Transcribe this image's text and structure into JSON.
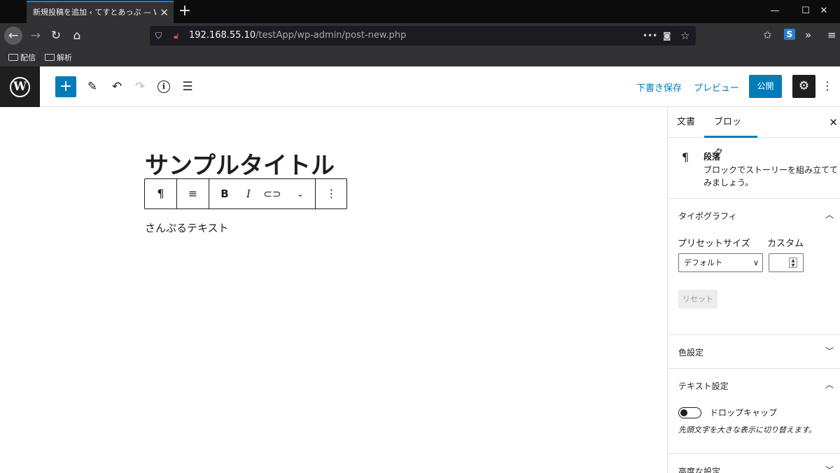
{
  "browser": {
    "tab_title": "新規投稿を追加 ‹ てすとあっぷ — Wor",
    "tab_close": "✕",
    "new_tab": "+",
    "url_host": "192.168.55.10",
    "url_path": "/testApp/wp-admin/post-new.php",
    "url_menu": "•••",
    "bookmarks": [
      "配信",
      "解析"
    ]
  },
  "toolbar": {
    "add_icon": "+",
    "save_draft": "下書き保存",
    "preview": "プレビュー",
    "publish": "公開"
  },
  "editor": {
    "title": "サンプルタイトル",
    "paragraph": "さんぷるテキスト"
  },
  "sidebar": {
    "tabs": [
      "文書",
      "ブロック"
    ],
    "active_tab": "ブロック",
    "block_card": {
      "title": "段落",
      "description": "ブロックでストーリーを組み立ててみましょう。"
    },
    "typography": {
      "title": "タイポグラフィ",
      "preset_label": "プリセットサイズ",
      "custom_label": "カスタム",
      "preset_value": "デフォルト",
      "reset": "リセット"
    },
    "color": {
      "title": "色設定"
    },
    "text_settings": {
      "title": "テキスト設定",
      "drop_cap_label": "ドロップキャップ",
      "drop_cap_help": "先頭文字を大きな表示に切り替えます。"
    },
    "advanced": {
      "title": "高度な設定"
    }
  },
  "colors": {
    "accent": "#007cba",
    "dark": "#1e1e1e",
    "browser_bg": "#323234"
  }
}
